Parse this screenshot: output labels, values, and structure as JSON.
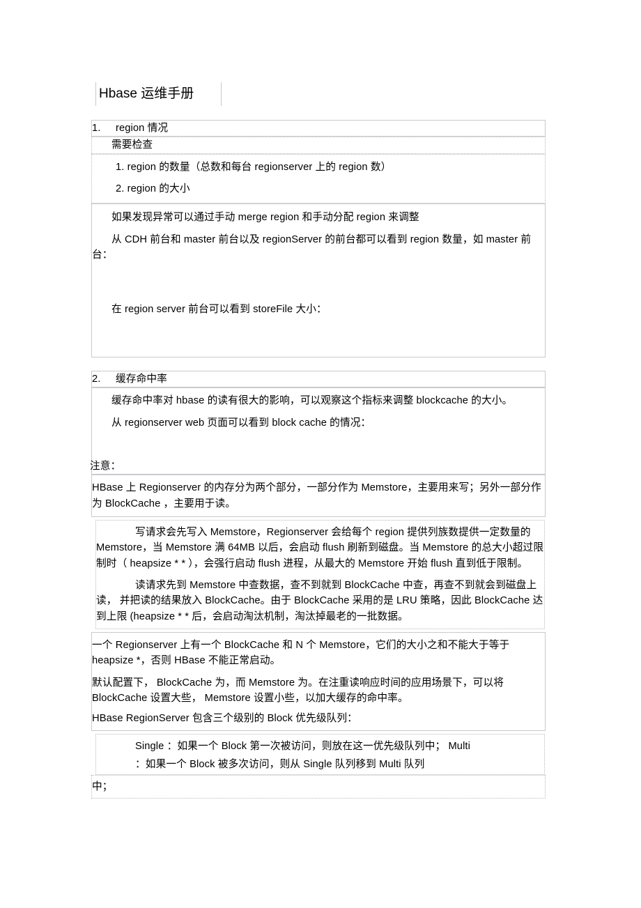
{
  "document": {
    "title": "Hbase 运维手册",
    "sections": [
      {
        "id": "section-1",
        "number": "1.",
        "heading": "region 情况",
        "sub_heading": "需要检查",
        "checklist": [
          "1. region    的数量（总数和每台    regionserver    上的  region  数）",
          "2. region    的大小"
        ],
        "body": [
          "如果发现异常可以通过手动    merge region  和手动分配   region   来调整",
          "从 CDH 前台和 master 前台以及 regionServer  的前台都可以看到 region  数量，如 master 前台：",
          "在 region server    前台可以看到   storeFile    大小："
        ]
      },
      {
        "id": "section-2",
        "number": "2.",
        "heading": "缓存命中率",
        "body": [
          "缓存命中率对 hbase 的读有很大的影响，可以观察这个指标来调整 blockcache 的大小。",
          "从 regionserver web    页面可以看到   block cache  的情况："
        ],
        "note_label": "注意：",
        "note_blocks": [
          {
            "id": "note-memory-split",
            "lines": [
              "HBase 上 Regionserver 的内存分为两个部分，一部分作为 Memstore，主要用来写；另外一部分作为 BlockCache ，主要用于读。"
            ]
          },
          {
            "id": "note-write-read-path",
            "lines": [
              "写请求会先写入 Memstore，Regionserver 会给每个 region 提供列族数提供一定数量的 Memstore，当 Memstore 满 64MB 以后，会启动 flush 刷新到磁盘。当 Memstore 的总大小超过限制时（   heapsize * *        ），会强行启动   flush 进程，从最大的   Memstore 开始 flush   直到低于限制。",
              "读请求先到 Memstore 中查数据，查不到就到     BlockCache 中查，再查不到就会到磁盘上读，   并把读的结果放入   BlockCache。由于 BlockCache 采用的是 LRU 策略，因此  BlockCache 达到上限 (heapsize * *     后，会启动淘汰机制，淘汰掉最老的一批数据。"
            ]
          },
          {
            "id": "note-heapsize-config",
            "lines": [
              "一个 Regionserver 上有一个 BlockCache 和 N 个 Memstore，它们的大小之和不能大于等于 heapsize *，否则 HBase 不能正常启动。",
              "默认配置下， BlockCache 为，而 Memstore 为。在注重读响应时间的应用场景下，可以将 BlockCache 设置大些， Memstore 设置小些，以加大缓存的命中率。",
              "HBase RegionServer 包含三个级别的 Block 优先级队列："
            ]
          },
          {
            "id": "note-block-priority",
            "lines": [
              "Single ：如果一个 Block 第一次被访问，则放在这一优先级队列中； Multi",
              "：如果一个 Block 被多次访问，则从 Single 队列移到 Multi 队列",
              "中；"
            ]
          }
        ]
      }
    ]
  }
}
